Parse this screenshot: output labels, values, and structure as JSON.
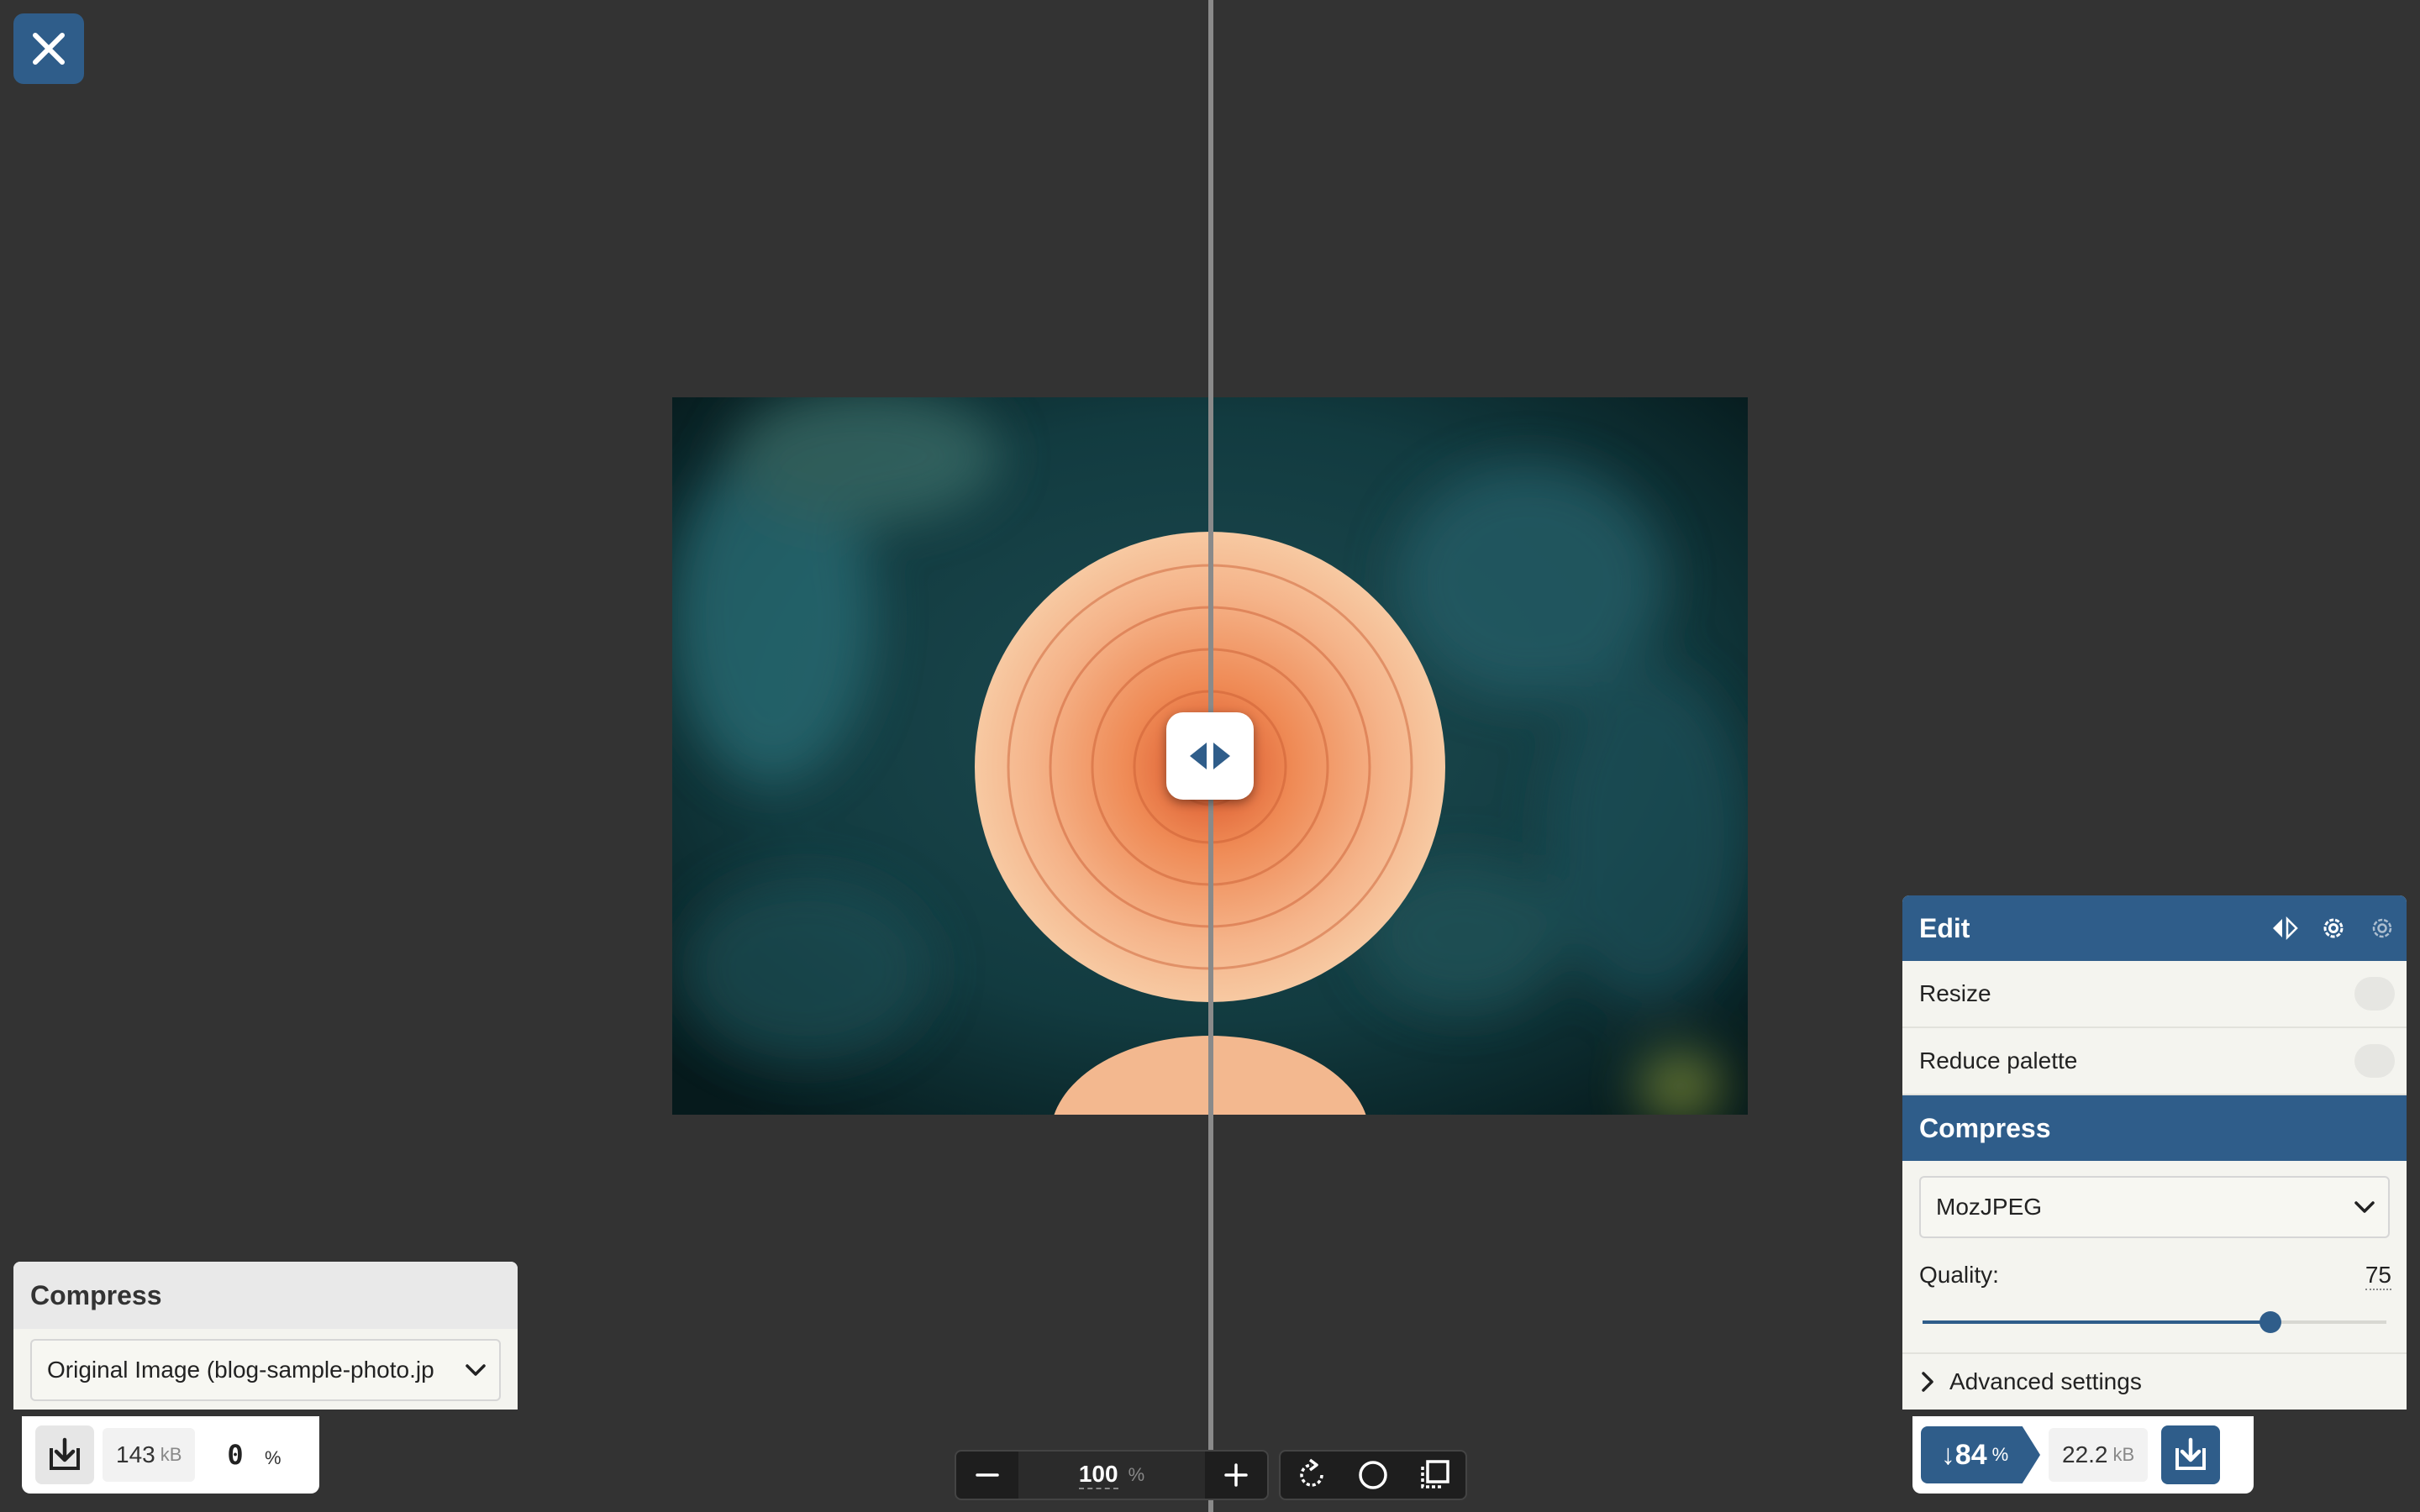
{
  "colors": {
    "accent": "#2f5d8a",
    "background": "#333333",
    "panel": "#f4f4ef"
  },
  "left_panel": {
    "title": "Compress",
    "select_value": "Original Image (blog-sample-photo.jp",
    "size_value": "143",
    "size_unit": "kB",
    "percent_value": "0",
    "percent_unit": "%"
  },
  "zoom": {
    "value": "100",
    "unit": "%"
  },
  "right_panel": {
    "edit_title": "Edit",
    "resize_label": "Resize",
    "reduce_palette_label": "Reduce palette",
    "compress_title": "Compress",
    "encoder_value": "MozJPEG",
    "quality_label": "Quality:",
    "quality_value": "75",
    "quality_fraction": 0.75,
    "advanced_label": "Advanced settings",
    "savings_value": "↓84",
    "savings_unit": "%",
    "size_value": "22.2",
    "size_unit": "kB"
  },
  "icons": {
    "close": "close-icon",
    "split": "split-view-icon",
    "settings": "gear-icon",
    "download": "download-icon",
    "minus": "minus-icon",
    "plus": "plus-icon",
    "rotate": "rotate-icon",
    "background": "circle-icon",
    "crop": "crop-icon"
  }
}
